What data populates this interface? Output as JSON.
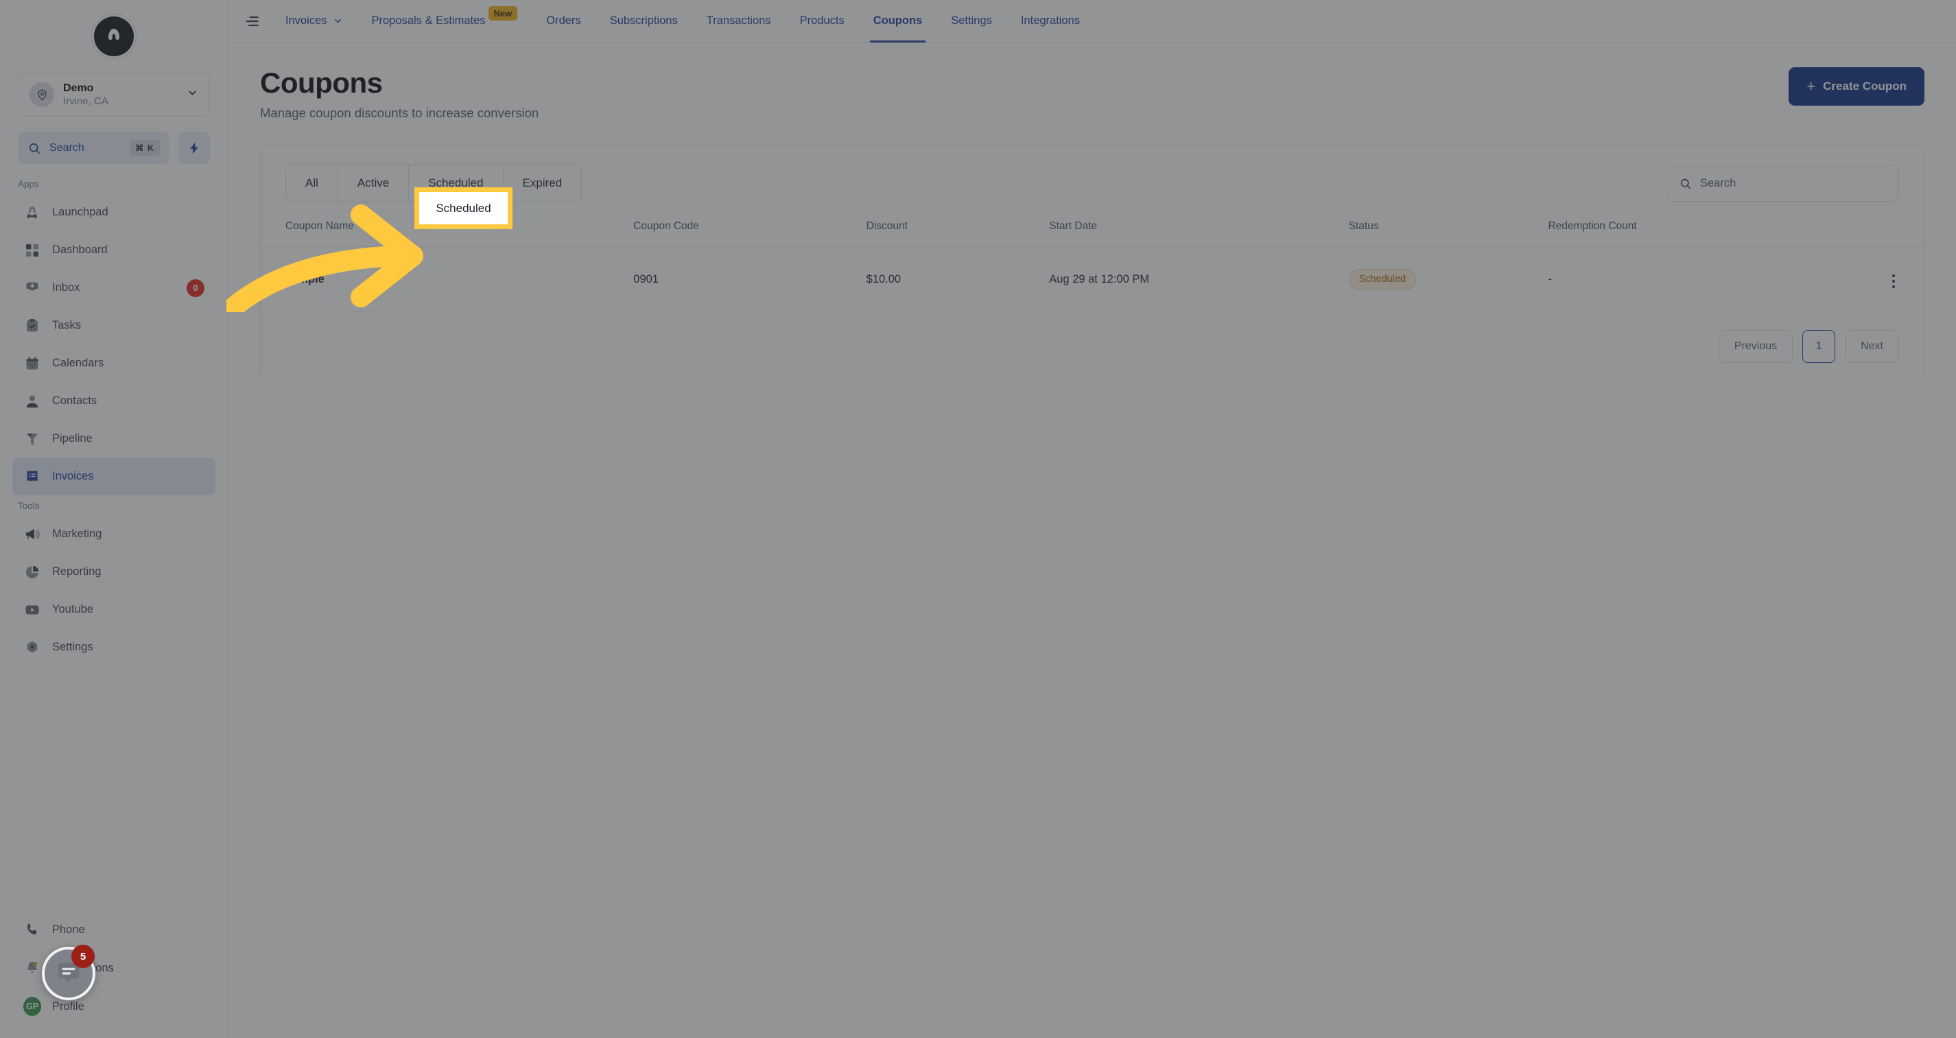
{
  "sidebar": {
    "logo_icon": "app-logo-icon",
    "location": {
      "name": "Demo",
      "sublabel": "Irvine, CA",
      "avatar_icon": "location-pin-icon",
      "chevron_icon": "chevron-down-icon"
    },
    "search": {
      "label": "Search",
      "shortcut": "⌘ K",
      "icon": "search-icon"
    },
    "quick_action_icon": "lightning-bolt-icon",
    "sections": [
      {
        "label": "Apps",
        "items": [
          {
            "label": "Launchpad",
            "icon": "rocket-icon",
            "active": false,
            "badge": ""
          },
          {
            "label": "Dashboard",
            "icon": "grid-icon",
            "active": false,
            "badge": ""
          },
          {
            "label": "Inbox",
            "icon": "inbox-icon",
            "active": false,
            "badge": "0"
          },
          {
            "label": "Tasks",
            "icon": "clipboard-check-icon",
            "active": false,
            "badge": ""
          },
          {
            "label": "Calendars",
            "icon": "calendar-icon",
            "active": false,
            "badge": ""
          },
          {
            "label": "Contacts",
            "icon": "user-icon",
            "active": false,
            "badge": ""
          },
          {
            "label": "Pipeline",
            "icon": "funnel-icon",
            "active": false,
            "badge": ""
          },
          {
            "label": "Invoices",
            "icon": "invoice-icon",
            "active": true,
            "badge": ""
          }
        ]
      },
      {
        "label": "Tools",
        "items": [
          {
            "label": "Marketing",
            "icon": "megaphone-icon",
            "active": false,
            "badge": ""
          },
          {
            "label": "Reporting",
            "icon": "pie-chart-icon",
            "active": false,
            "badge": ""
          },
          {
            "label": "Youtube",
            "icon": "youtube-icon",
            "active": false,
            "badge": ""
          },
          {
            "label": "Settings",
            "icon": "gear-icon",
            "active": false,
            "badge": ""
          }
        ]
      }
    ],
    "footer_items": [
      {
        "label": "Phone",
        "icon": "phone-icon",
        "badge": ""
      },
      {
        "label": "Notifications",
        "icon": "bell-icon",
        "badge": ""
      },
      {
        "label": "Profile",
        "icon": "avatar-initials",
        "badge": "",
        "initials": "GP"
      }
    ]
  },
  "topbar": {
    "menu_icon": "hamburger-menu-icon",
    "tabs": [
      {
        "label": "Invoices",
        "active": false,
        "chevron": true,
        "badge": ""
      },
      {
        "label": "Proposals & Estimates",
        "active": false,
        "chevron": false,
        "badge": "New"
      },
      {
        "label": "Orders",
        "active": false,
        "chevron": false,
        "badge": ""
      },
      {
        "label": "Subscriptions",
        "active": false,
        "chevron": false,
        "badge": ""
      },
      {
        "label": "Transactions",
        "active": false,
        "chevron": false,
        "badge": ""
      },
      {
        "label": "Products",
        "active": false,
        "chevron": false,
        "badge": ""
      },
      {
        "label": "Coupons",
        "active": true,
        "chevron": false,
        "badge": ""
      },
      {
        "label": "Settings",
        "active": false,
        "chevron": false,
        "badge": ""
      },
      {
        "label": "Integrations",
        "active": false,
        "chevron": false,
        "badge": ""
      }
    ]
  },
  "page": {
    "title": "Coupons",
    "subtitle": "Manage coupon discounts to increase conversion",
    "create_button": {
      "label": "Create Coupon",
      "icon": "plus-icon"
    }
  },
  "filters": {
    "tabs": [
      {
        "label": "All",
        "selected": false
      },
      {
        "label": "Active",
        "selected": false
      },
      {
        "label": "Scheduled",
        "selected": true
      },
      {
        "label": "Expired",
        "selected": false
      }
    ],
    "highlighted_tab": "Scheduled"
  },
  "search": {
    "placeholder": "Search",
    "value": "",
    "icon": "search-icon"
  },
  "table": {
    "columns": [
      "Coupon Name",
      "Coupon Code",
      "Discount",
      "Start Date",
      "Status",
      "Redemption Count",
      ""
    ],
    "rows": [
      {
        "coupon_name": "sample",
        "coupon_code": "0901",
        "discount": "$10.00",
        "start_date": "Aug 29 at 12:00 PM",
        "status": "Scheduled",
        "redemption_count": "-",
        "menu_icon": "kebab-menu-icon"
      }
    ]
  },
  "pagination": {
    "previous_label": "Previous",
    "next_label": "Next",
    "current_page": "1"
  },
  "chat_widget": {
    "icon": "chat-bubble-icon",
    "unread": "5"
  },
  "colors": {
    "accent": "#2b4ba0",
    "primary_button": "#1b3a8c",
    "highlight": "#ffc93f",
    "status_scheduled": "#a66a12",
    "badge_new": "#f0b429",
    "badge_count": "#e0352b"
  }
}
